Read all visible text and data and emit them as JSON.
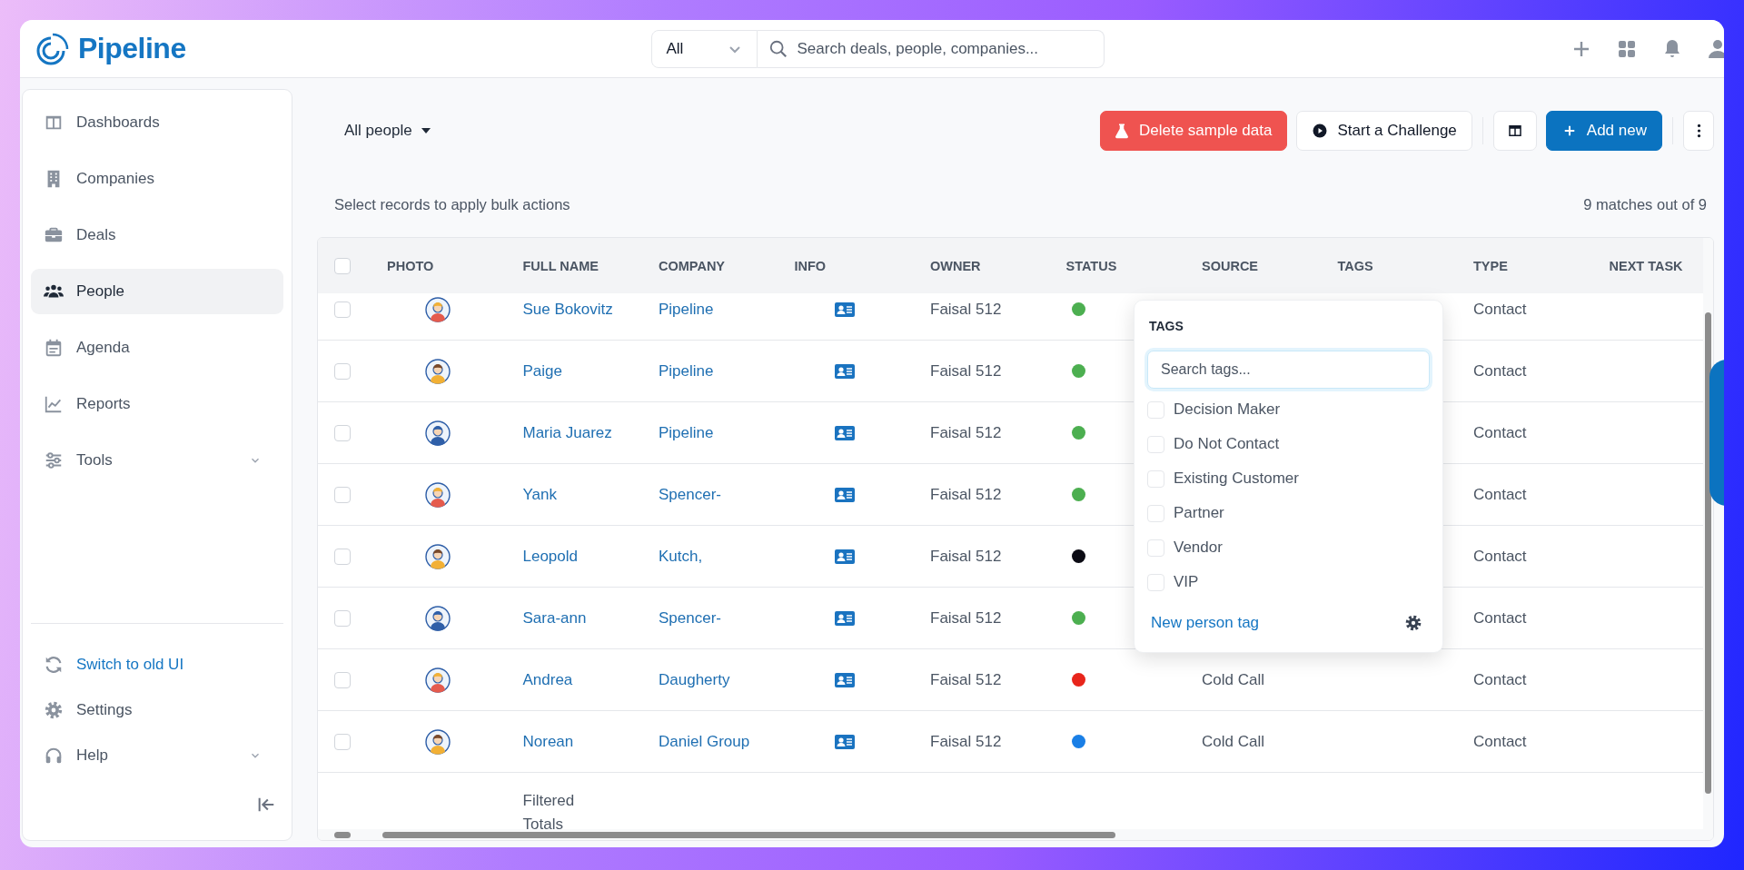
{
  "brand": {
    "name": "Pipeline"
  },
  "search": {
    "scope": "All",
    "placeholder": "Search deals, people, companies..."
  },
  "sidebar": {
    "items": [
      {
        "label": "Dashboards",
        "selected": false,
        "expandable": false
      },
      {
        "label": "Companies",
        "selected": false,
        "expandable": false
      },
      {
        "label": "Deals",
        "selected": false,
        "expandable": false
      },
      {
        "label": "People",
        "selected": true,
        "expandable": false
      },
      {
        "label": "Agenda",
        "selected": false,
        "expandable": false
      },
      {
        "label": "Reports",
        "selected": false,
        "expandable": false
      },
      {
        "label": "Tools",
        "selected": false,
        "expandable": true
      }
    ],
    "footer_items": [
      {
        "label": "Switch to old UI",
        "kind": "link",
        "expandable": false
      },
      {
        "label": "Settings",
        "kind": "plain",
        "expandable": false
      },
      {
        "label": "Help",
        "kind": "plain",
        "expandable": true
      }
    ]
  },
  "view": {
    "label": "All people"
  },
  "actions": [
    {
      "kind": "danger",
      "label": "Delete sample data"
    },
    {
      "kind": "outline",
      "label": "Start a Challenge"
    },
    {
      "kind": "layout"
    },
    {
      "kind": "primary",
      "label": "Add new"
    },
    {
      "kind": "more"
    }
  ],
  "bulk_hint": "Select records to apply bulk actions",
  "match_count": "9 matches out of 9",
  "table": {
    "select_all": {
      "checked": false
    },
    "columns": [
      "PHOTO",
      "FULL NAME",
      "COMPANY",
      "INFO",
      "OWNER",
      "STATUS",
      "SOURCE",
      "TAGS",
      "TYPE",
      "NEXT TASK"
    ],
    "rows": [
      {
        "checked": false,
        "name": "Sue Bokovitz",
        "company": "Pipeline",
        "owner": "Faisal 512",
        "color": "#4caf50",
        "type": "Contact"
      },
      {
        "checked": false,
        "name": "Paige",
        "company": "Pipeline",
        "owner": "Faisal 512",
        "color": "#4caf50",
        "type": "Contact"
      },
      {
        "checked": false,
        "name": "Maria Juarez",
        "company": "Pipeline",
        "owner": "Faisal 512",
        "color": "#4caf50",
        "type": "Contact"
      },
      {
        "checked": false,
        "name": "Yank",
        "company": "Spencer-",
        "owner": "Faisal 512",
        "color": "#4caf50",
        "type": "Contact"
      },
      {
        "checked": false,
        "name": "Leopold",
        "company": "Kutch,",
        "owner": "Faisal 512",
        "color": "#0b0b14",
        "type": "Contact"
      },
      {
        "checked": false,
        "name": "Sara-ann",
        "company": "Spencer-",
        "owner": "Faisal 512",
        "color": "#4caf50",
        "type": "Contact"
      },
      {
        "checked": false,
        "name": "Andrea",
        "company": "Daugherty",
        "owner": "Faisal 512",
        "color": "#e8251b",
        "source": "Cold Call",
        "type": "Contact"
      },
      {
        "checked": false,
        "name": "Norean",
        "company": "Daniel Group",
        "owner": "Faisal 512",
        "color": "#1a7fe6",
        "source": "Cold Call",
        "type": "Contact"
      }
    ],
    "footer": "Filtered Totals"
  },
  "tags_popup": {
    "title": "TAGS",
    "placeholder": "Search tags...",
    "options": [
      {
        "label": "Decision Maker",
        "checked": false
      },
      {
        "label": "Do Not Contact",
        "checked": false
      },
      {
        "label": "Existing Customer",
        "checked": false
      },
      {
        "label": "Partner",
        "checked": false
      },
      {
        "label": "Vendor",
        "checked": false
      },
      {
        "label": "VIP",
        "checked": false
      }
    ],
    "link": "New person tag"
  }
}
